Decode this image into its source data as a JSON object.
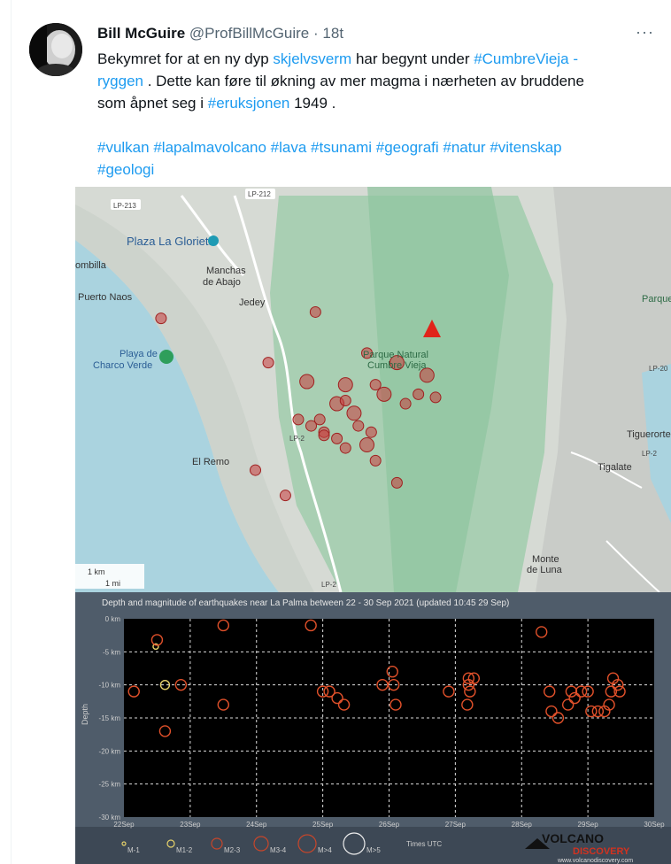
{
  "tweet": {
    "author_name": "Bill McGuire",
    "handle": "@ProfBillMcGuire",
    "separator": "·",
    "time": "18t",
    "more_label": "···",
    "line1_text": "Bekymret for at en ny dyp ",
    "link_skjelvsverm": "skjelvsverm",
    "line1_mid": " har begynt under ",
    "link_cumbre": "#CumbreVieja -",
    "link_ryggen": "ryggen",
    "line2_text": " . Dette kan føre til økning av mer magma i nærheten av bruddene",
    "line3_text": "som åpnet seg i ",
    "link_eruksjonen": "#eruksjonen",
    "line3_end": " 1949 .",
    "hashtags_line1": [
      "#vulkan",
      "#lapalmavolcano",
      "#lava",
      "#tsunami",
      "#geografi",
      "#natur",
      "#vitenskap"
    ],
    "hashtags_line2": [
      "#geologi"
    ]
  },
  "map": {
    "labels": {
      "lp213": "LP-213",
      "lp212": "LP-212",
      "plaza": "Plaza La Glorieta",
      "ombilla": "ombilla",
      "manchas1": "Manchas",
      "manchas2": "de Abajo",
      "puerto": "Puerto Naos",
      "jedey": "Jedey",
      "playa1": "Playa de",
      "playa2": "Charco Verde",
      "parque1": "Parque Natural",
      "parque2": "Cumbre Vieja",
      "parque_right": "Parque",
      "lp20": "LP-20",
      "lp2a": "LP-2",
      "lp2b": "LP-2",
      "lp2c": "LP-2",
      "elremo": "El Remo",
      "tiguerorte": "Tiguerorte",
      "tigalate": "Tigalate",
      "monte1": "Monte",
      "monte2": "de Luna",
      "scale_km": "1 km",
      "scale_mi": "1 mi"
    },
    "colors": {
      "water": "#aad3df",
      "land": "#d8dcd6",
      "park": "#a3cbb0",
      "quake": "#c83c3c"
    }
  },
  "chart_data": {
    "type": "scatter",
    "title": "Depth and magnitude of earthquakes near La Palma between 22 - 30 Sep 2021 (updated 10:45 29 Sep)",
    "ylabel": "Depth",
    "xlabel": "",
    "x_ticks": [
      "22Sep",
      "23Sep",
      "24Sep",
      "25Sep",
      "26Sep",
      "27Sep",
      "28Sep",
      "29Sep",
      "30Sep"
    ],
    "y_ticks": [
      "0 km",
      "-5 km",
      "-10 km",
      "-15 km",
      "-20 km",
      "-25 km",
      "-30 km"
    ],
    "xlim": [
      22,
      30
    ],
    "ylim": [
      -30,
      0
    ],
    "grid": true,
    "legend": [
      "M-1",
      "M1-2",
      "M2-3",
      "M3-4",
      "M>4",
      "M>5"
    ],
    "times_label": "Times UTC",
    "brand1": "VOLCANO",
    "brand2": "DISCOVERY",
    "brand_url": "www.volcanodiscovery.com",
    "points": [
      {
        "x": 22.15,
        "y": -11,
        "m": 3
      },
      {
        "x": 22.48,
        "y": -4.2,
        "m": 1
      },
      {
        "x": 22.5,
        "y": -3.2,
        "m": 3
      },
      {
        "x": 22.62,
        "y": -10,
        "m": 2
      },
      {
        "x": 22.62,
        "y": -17,
        "m": 3
      },
      {
        "x": 22.86,
        "y": -10,
        "m": 3
      },
      {
        "x": 23.5,
        "y": -1,
        "m": 3
      },
      {
        "x": 23.5,
        "y": -13,
        "m": 3
      },
      {
        "x": 24.82,
        "y": -1,
        "m": 3
      },
      {
        "x": 25.0,
        "y": -11,
        "m": 3
      },
      {
        "x": 25.1,
        "y": -11,
        "m": 3
      },
      {
        "x": 25.22,
        "y": -12,
        "m": 3
      },
      {
        "x": 25.32,
        "y": -13,
        "m": 3
      },
      {
        "x": 25.9,
        "y": -10,
        "m": 3
      },
      {
        "x": 26.05,
        "y": -8,
        "m": 3
      },
      {
        "x": 26.07,
        "y": -10,
        "m": 3
      },
      {
        "x": 26.1,
        "y": -13,
        "m": 3
      },
      {
        "x": 26.9,
        "y": -11,
        "m": 3
      },
      {
        "x": 27.2,
        "y": -9,
        "m": 3
      },
      {
        "x": 27.2,
        "y": -10,
        "m": 3
      },
      {
        "x": 27.22,
        "y": -11,
        "m": 3
      },
      {
        "x": 27.18,
        "y": -13,
        "m": 3
      },
      {
        "x": 27.28,
        "y": -9,
        "m": 3
      },
      {
        "x": 28.3,
        "y": -2,
        "m": 3
      },
      {
        "x": 28.42,
        "y": -11,
        "m": 3
      },
      {
        "x": 28.45,
        "y": -14,
        "m": 3
      },
      {
        "x": 28.55,
        "y": -15,
        "m": 3
      },
      {
        "x": 28.7,
        "y": -13,
        "m": 3
      },
      {
        "x": 28.75,
        "y": -11,
        "m": 3
      },
      {
        "x": 28.8,
        "y": -12,
        "m": 3
      },
      {
        "x": 28.9,
        "y": -11,
        "m": 3
      },
      {
        "x": 29.0,
        "y": -11,
        "m": 3
      },
      {
        "x": 29.05,
        "y": -14,
        "m": 3
      },
      {
        "x": 29.15,
        "y": -14,
        "m": 3
      },
      {
        "x": 29.25,
        "y": -14,
        "m": 3
      },
      {
        "x": 29.32,
        "y": -13,
        "m": 3
      },
      {
        "x": 29.35,
        "y": -11,
        "m": 3
      },
      {
        "x": 29.38,
        "y": -9,
        "m": 3
      },
      {
        "x": 29.45,
        "y": -10,
        "m": 3
      },
      {
        "x": 29.48,
        "y": -11,
        "m": 3
      }
    ]
  },
  "map_quakes": [
    {
      "lon": 0.56,
      "lat": 0.34,
      "m": 2
    },
    {
      "lon": 0.2,
      "lat": 0.36,
      "m": 2
    },
    {
      "lon": 0.45,
      "lat": 0.5,
      "m": 2
    },
    {
      "lon": 0.54,
      "lat": 0.56,
      "m": 3
    },
    {
      "lon": 0.63,
      "lat": 0.57,
      "m": 3
    },
    {
      "lon": 0.68,
      "lat": 0.47,
      "m": 2
    },
    {
      "lon": 0.7,
      "lat": 0.57,
      "m": 2
    },
    {
      "lon": 0.72,
      "lat": 0.6,
      "m": 3
    },
    {
      "lon": 0.75,
      "lat": 0.5,
      "m": 3
    },
    {
      "lon": 0.82,
      "lat": 0.54,
      "m": 3
    },
    {
      "lon": 0.8,
      "lat": 0.6,
      "m": 2
    },
    {
      "lon": 0.61,
      "lat": 0.63,
      "m": 3
    },
    {
      "lon": 0.65,
      "lat": 0.66,
      "m": 3
    },
    {
      "lon": 0.57,
      "lat": 0.68,
      "m": 2
    },
    {
      "lon": 0.52,
      "lat": 0.68,
      "m": 2
    },
    {
      "lon": 0.55,
      "lat": 0.7,
      "m": 2
    },
    {
      "lon": 0.58,
      "lat": 0.72,
      "m": 2
    },
    {
      "lon": 0.61,
      "lat": 0.74,
      "m": 2
    },
    {
      "lon": 0.63,
      "lat": 0.77,
      "m": 2
    },
    {
      "lon": 0.66,
      "lat": 0.7,
      "m": 2
    },
    {
      "lon": 0.68,
      "lat": 0.76,
      "m": 3
    },
    {
      "lon": 0.69,
      "lat": 0.72,
      "m": 2
    },
    {
      "lon": 0.77,
      "lat": 0.63,
      "m": 2
    },
    {
      "lon": 0.84,
      "lat": 0.61,
      "m": 2
    },
    {
      "lon": 0.75,
      "lat": 0.88,
      "m": 2
    },
    {
      "lon": 0.42,
      "lat": 0.84,
      "m": 2
    },
    {
      "lon": 0.7,
      "lat": 0.81,
      "m": 2
    },
    {
      "lon": 0.58,
      "lat": 0.73,
      "m": 2
    },
    {
      "lon": 0.63,
      "lat": 0.62,
      "m": 2
    },
    {
      "lon": 0.49,
      "lat": 0.92,
      "m": 2
    }
  ]
}
